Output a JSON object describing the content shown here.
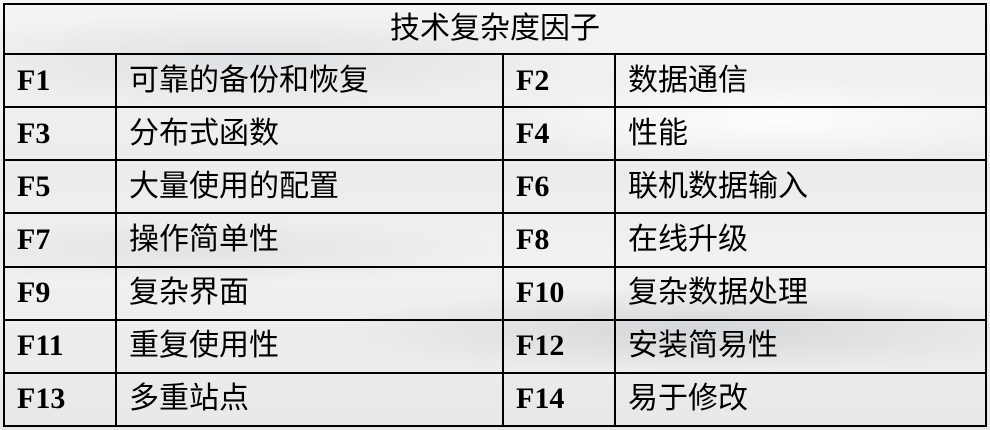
{
  "table": {
    "title": "技术复杂度因子",
    "rows": [
      {
        "left": {
          "code": "F1",
          "name": "可靠的备份和恢复"
        },
        "right": {
          "code": "F2",
          "name": "数据通信"
        }
      },
      {
        "left": {
          "code": "F3",
          "name": "分布式函数"
        },
        "right": {
          "code": "F4",
          "name": "性能"
        }
      },
      {
        "left": {
          "code": "F5",
          "name": "大量使用的配置"
        },
        "right": {
          "code": "F6",
          "name": "联机数据输入"
        }
      },
      {
        "left": {
          "code": "F7",
          "name": "操作简单性"
        },
        "right": {
          "code": "F8",
          "name": "在线升级"
        }
      },
      {
        "left": {
          "code": "F9",
          "name": "复杂界面"
        },
        "right": {
          "code": "F10",
          "name": "复杂数据处理"
        }
      },
      {
        "left": {
          "code": "F11",
          "name": "重复使用性"
        },
        "right": {
          "code": "F12",
          "name": "安装简易性"
        }
      },
      {
        "left": {
          "code": "F13",
          "name": "多重站点"
        },
        "right": {
          "code": "F14",
          "name": "易于修改"
        }
      }
    ]
  }
}
